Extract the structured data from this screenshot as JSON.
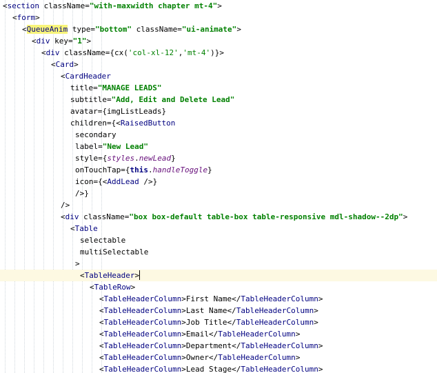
{
  "editor": {
    "current_line": 23,
    "lines": [
      {
        "indent": 0,
        "tokens": [
          [
            "t-punct",
            "<"
          ],
          [
            "t-tag",
            "section"
          ],
          [
            "t-attr",
            " className="
          ],
          [
            "t-str",
            "\"with-maxwidth chapter mt-4\""
          ],
          [
            "t-punct",
            ">"
          ]
        ]
      },
      {
        "indent": 1,
        "tokens": [
          [
            "t-punct",
            "<"
          ],
          [
            "t-tag",
            "form"
          ],
          [
            "t-punct",
            ">"
          ]
        ]
      },
      {
        "indent": 2,
        "tokens": [
          [
            "t-punct",
            "<"
          ],
          [
            "t-tag t-hl",
            "QueueAnim"
          ],
          [
            "t-attr",
            " type="
          ],
          [
            "t-str",
            "\"bottom\""
          ],
          [
            "t-attr",
            " className="
          ],
          [
            "t-str",
            "\"ui-animate\""
          ],
          [
            "t-punct",
            ">"
          ]
        ]
      },
      {
        "indent": 3,
        "tokens": [
          [
            "t-punct",
            "<"
          ],
          [
            "t-tag",
            "div"
          ],
          [
            "t-attr",
            " key="
          ],
          [
            "t-str",
            "\"1\""
          ],
          [
            "t-punct",
            ">"
          ]
        ]
      },
      {
        "indent": 4,
        "tokens": [
          [
            "t-punct",
            "<"
          ],
          [
            "t-tag",
            "div"
          ],
          [
            "t-attr",
            " className="
          ],
          [
            "t-punct",
            "{"
          ],
          [
            "t-js-id",
            "cx("
          ],
          [
            "t-js-str",
            "'col-xl-12'"
          ],
          [
            "t-js-id",
            ","
          ],
          [
            "t-js-str",
            "'mt-4'"
          ],
          [
            "t-js-id",
            ")"
          ],
          [
            "t-punct",
            "}"
          ],
          [
            "t-punct",
            ">"
          ]
        ]
      },
      {
        "indent": 5,
        "tokens": [
          [
            "t-punct",
            "<"
          ],
          [
            "t-tag",
            "Card"
          ],
          [
            "t-punct",
            ">"
          ]
        ]
      },
      {
        "indent": 6,
        "tokens": [
          [
            "t-punct",
            "<"
          ],
          [
            "t-tag",
            "CardHeader"
          ]
        ]
      },
      {
        "indent": 7,
        "tokens": [
          [
            "t-attr",
            "title="
          ],
          [
            "t-str",
            "\"MANAGE LEADS\""
          ]
        ]
      },
      {
        "indent": 7,
        "tokens": [
          [
            "t-attr",
            "subtitle="
          ],
          [
            "t-str",
            "\"Add, Edit and Delete Lead\""
          ]
        ]
      },
      {
        "indent": 7,
        "tokens": [
          [
            "t-attr",
            "avatar="
          ],
          [
            "t-punct",
            "{"
          ],
          [
            "t-js-id",
            "imgListLeads"
          ],
          [
            "t-punct",
            "}"
          ]
        ]
      },
      {
        "indent": 7,
        "tokens": [
          [
            "t-attr",
            "children="
          ],
          [
            "t-punct",
            "{"
          ],
          [
            "t-punct",
            "<"
          ],
          [
            "t-tag",
            "RaisedButton"
          ]
        ]
      },
      {
        "indent": 7,
        "pad": 1,
        "tokens": [
          [
            "t-attr",
            "secondary"
          ]
        ]
      },
      {
        "indent": 7,
        "pad": 1,
        "tokens": [
          [
            "t-attr",
            "label="
          ],
          [
            "t-str",
            "\"New Lead\""
          ]
        ]
      },
      {
        "indent": 7,
        "pad": 1,
        "tokens": [
          [
            "t-attr",
            "style="
          ],
          [
            "t-punct",
            "{"
          ],
          [
            "t-js-field",
            "styles"
          ],
          [
            "t-js-id",
            "."
          ],
          [
            "t-js-field",
            "newLead"
          ],
          [
            "t-punct",
            "}"
          ]
        ]
      },
      {
        "indent": 7,
        "pad": 1,
        "tokens": [
          [
            "t-attr",
            "onTouchTap="
          ],
          [
            "t-punct",
            "{"
          ],
          [
            "t-js-kw",
            "this"
          ],
          [
            "t-js-id",
            "."
          ],
          [
            "t-js-field",
            "handleToggle"
          ],
          [
            "t-punct",
            "}"
          ]
        ]
      },
      {
        "indent": 7,
        "pad": 1,
        "tokens": [
          [
            "t-attr",
            "icon="
          ],
          [
            "t-punct",
            "{"
          ],
          [
            "t-punct",
            "<"
          ],
          [
            "t-tag",
            "AddLead"
          ],
          [
            "t-punct",
            " />"
          ],
          [
            "t-punct",
            "}"
          ]
        ]
      },
      {
        "indent": 7,
        "pad": 1,
        "tokens": [
          [
            "t-punct",
            "/>"
          ],
          [
            "t-punct",
            "}"
          ]
        ]
      },
      {
        "indent": 6,
        "tokens": [
          [
            "t-punct",
            "/>"
          ]
        ]
      },
      {
        "indent": 6,
        "tokens": [
          [
            "t-punct",
            "<"
          ],
          [
            "t-tag",
            "div"
          ],
          [
            "t-attr",
            " className="
          ],
          [
            "t-str",
            "\"box box-default table-box table-responsive mdl-shadow--2dp\""
          ],
          [
            "t-punct",
            ">"
          ]
        ]
      },
      {
        "indent": 7,
        "tokens": [
          [
            "t-punct",
            "<"
          ],
          [
            "t-tag",
            "Table"
          ]
        ]
      },
      {
        "indent": 8,
        "tokens": [
          [
            "t-attr",
            "selectable"
          ]
        ]
      },
      {
        "indent": 8,
        "tokens": [
          [
            "t-attr",
            "multiSelectable"
          ]
        ]
      },
      {
        "indent": 7,
        "pad": 1,
        "tokens": [
          [
            "t-punct",
            ">"
          ]
        ]
      },
      {
        "indent": 8,
        "caret": true,
        "tokens": [
          [
            "t-punct",
            "<"
          ],
          [
            "t-tag",
            "TableHeader"
          ],
          [
            "t-punct",
            ">"
          ]
        ]
      },
      {
        "indent": 9,
        "tokens": [
          [
            "t-punct",
            "<"
          ],
          [
            "t-tag",
            "TableRow"
          ],
          [
            "t-punct",
            ">"
          ]
        ]
      },
      {
        "indent": 10,
        "tokens": [
          [
            "t-punct",
            "<"
          ],
          [
            "t-tag",
            "TableHeaderColumn"
          ],
          [
            "t-punct",
            ">"
          ],
          [
            "t-text",
            "First Name"
          ],
          [
            "t-punct",
            "</"
          ],
          [
            "t-tag",
            "TableHeaderColumn"
          ],
          [
            "t-punct",
            ">"
          ]
        ]
      },
      {
        "indent": 10,
        "tokens": [
          [
            "t-punct",
            "<"
          ],
          [
            "t-tag",
            "TableHeaderColumn"
          ],
          [
            "t-punct",
            ">"
          ],
          [
            "t-text",
            "Last Name"
          ],
          [
            "t-punct",
            "</"
          ],
          [
            "t-tag",
            "TableHeaderColumn"
          ],
          [
            "t-punct",
            ">"
          ]
        ]
      },
      {
        "indent": 10,
        "tokens": [
          [
            "t-punct",
            "<"
          ],
          [
            "t-tag",
            "TableHeaderColumn"
          ],
          [
            "t-punct",
            ">"
          ],
          [
            "t-text",
            "Job Title"
          ],
          [
            "t-punct",
            "</"
          ],
          [
            "t-tag",
            "TableHeaderColumn"
          ],
          [
            "t-punct",
            ">"
          ]
        ]
      },
      {
        "indent": 10,
        "tokens": [
          [
            "t-punct",
            "<"
          ],
          [
            "t-tag",
            "TableHeaderColumn"
          ],
          [
            "t-punct",
            ">"
          ],
          [
            "t-text",
            "Email"
          ],
          [
            "t-punct",
            "</"
          ],
          [
            "t-tag",
            "TableHeaderColumn"
          ],
          [
            "t-punct",
            ">"
          ]
        ]
      },
      {
        "indent": 10,
        "tokens": [
          [
            "t-punct",
            "<"
          ],
          [
            "t-tag",
            "TableHeaderColumn"
          ],
          [
            "t-punct",
            ">"
          ],
          [
            "t-text",
            "Department"
          ],
          [
            "t-punct",
            "</"
          ],
          [
            "t-tag",
            "TableHeaderColumn"
          ],
          [
            "t-punct",
            ">"
          ]
        ]
      },
      {
        "indent": 10,
        "tokens": [
          [
            "t-punct",
            "<"
          ],
          [
            "t-tag",
            "TableHeaderColumn"
          ],
          [
            "t-punct",
            ">"
          ],
          [
            "t-text",
            "Owner"
          ],
          [
            "t-punct",
            "</"
          ],
          [
            "t-tag",
            "TableHeaderColumn"
          ],
          [
            "t-punct",
            ">"
          ]
        ]
      },
      {
        "indent": 10,
        "tokens": [
          [
            "t-punct",
            "<"
          ],
          [
            "t-tag",
            "TableHeaderColumn"
          ],
          [
            "t-punct",
            ">"
          ],
          [
            "t-text",
            "Lead Stage"
          ],
          [
            "t-punct",
            "</"
          ],
          [
            "t-tag",
            "TableHeaderColumn"
          ],
          [
            "t-punct",
            ">"
          ]
        ]
      }
    ]
  }
}
